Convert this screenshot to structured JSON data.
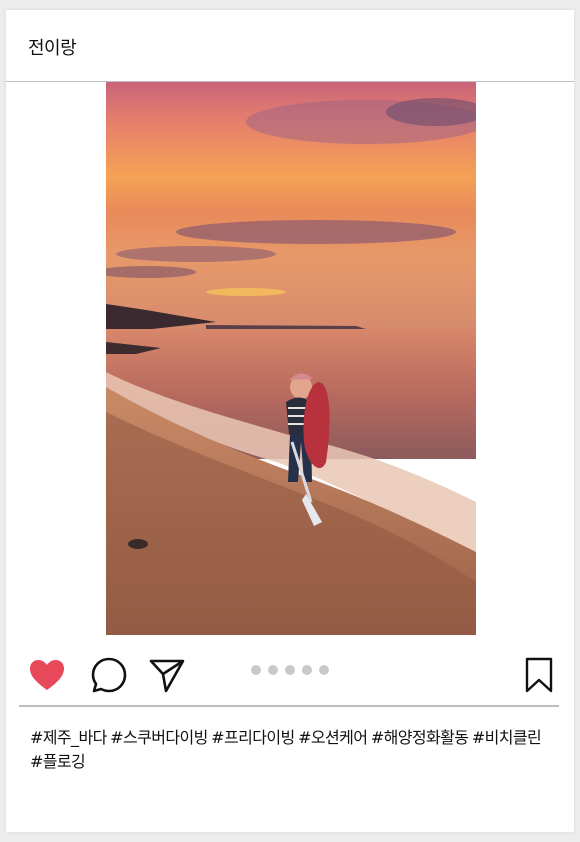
{
  "post": {
    "username": "전이랑",
    "caption": "#제주_바다 #스쿠버다이빙 #프리다이빙 #오션케어 #해양정화활동 #비치클린 #플로깅",
    "carousel_total": 5,
    "liked": true
  },
  "icons": {
    "like": "heart-icon",
    "comment": "comment-bubble-icon",
    "share": "paper-plane-icon",
    "save": "bookmark-icon"
  },
  "colors": {
    "heart": "#e8495a",
    "divider": "#bdbdbd",
    "dot": "#c9c9c9"
  }
}
